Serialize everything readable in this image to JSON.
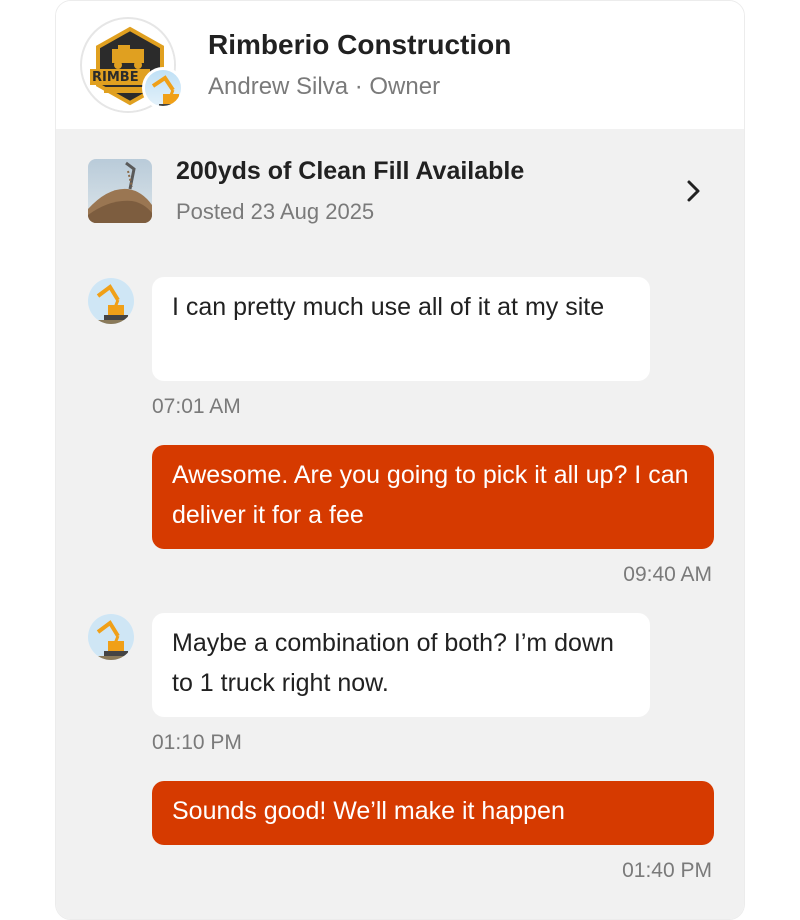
{
  "header": {
    "company_name": "Rimberio Construction",
    "owner_line": "Andrew Silva · Owner",
    "logo_text": "RIMBE"
  },
  "listing": {
    "title": "200yds of Clean Fill Available",
    "posted": "Posted 23 Aug 2025"
  },
  "messages": [
    {
      "direction": "incoming",
      "text": "I can pretty much use all of it at my site",
      "time": "07:01 AM"
    },
    {
      "direction": "outgoing",
      "text": "Awesome. Are you going to pick it all up? I can deliver it for a fee",
      "time": "09:40 AM"
    },
    {
      "direction": "incoming",
      "text": "Maybe a combination of both? I’m down to 1 truck right now.",
      "time": "01:10 PM"
    },
    {
      "direction": "outgoing",
      "text": "Sounds good! We’ll make it happen",
      "time": "01:40 PM"
    }
  ],
  "colors": {
    "accent": "#d63a00",
    "chat_background": "#f1f1f1",
    "logo_gold": "#e0a020",
    "logo_dark": "#2b2b2b"
  }
}
